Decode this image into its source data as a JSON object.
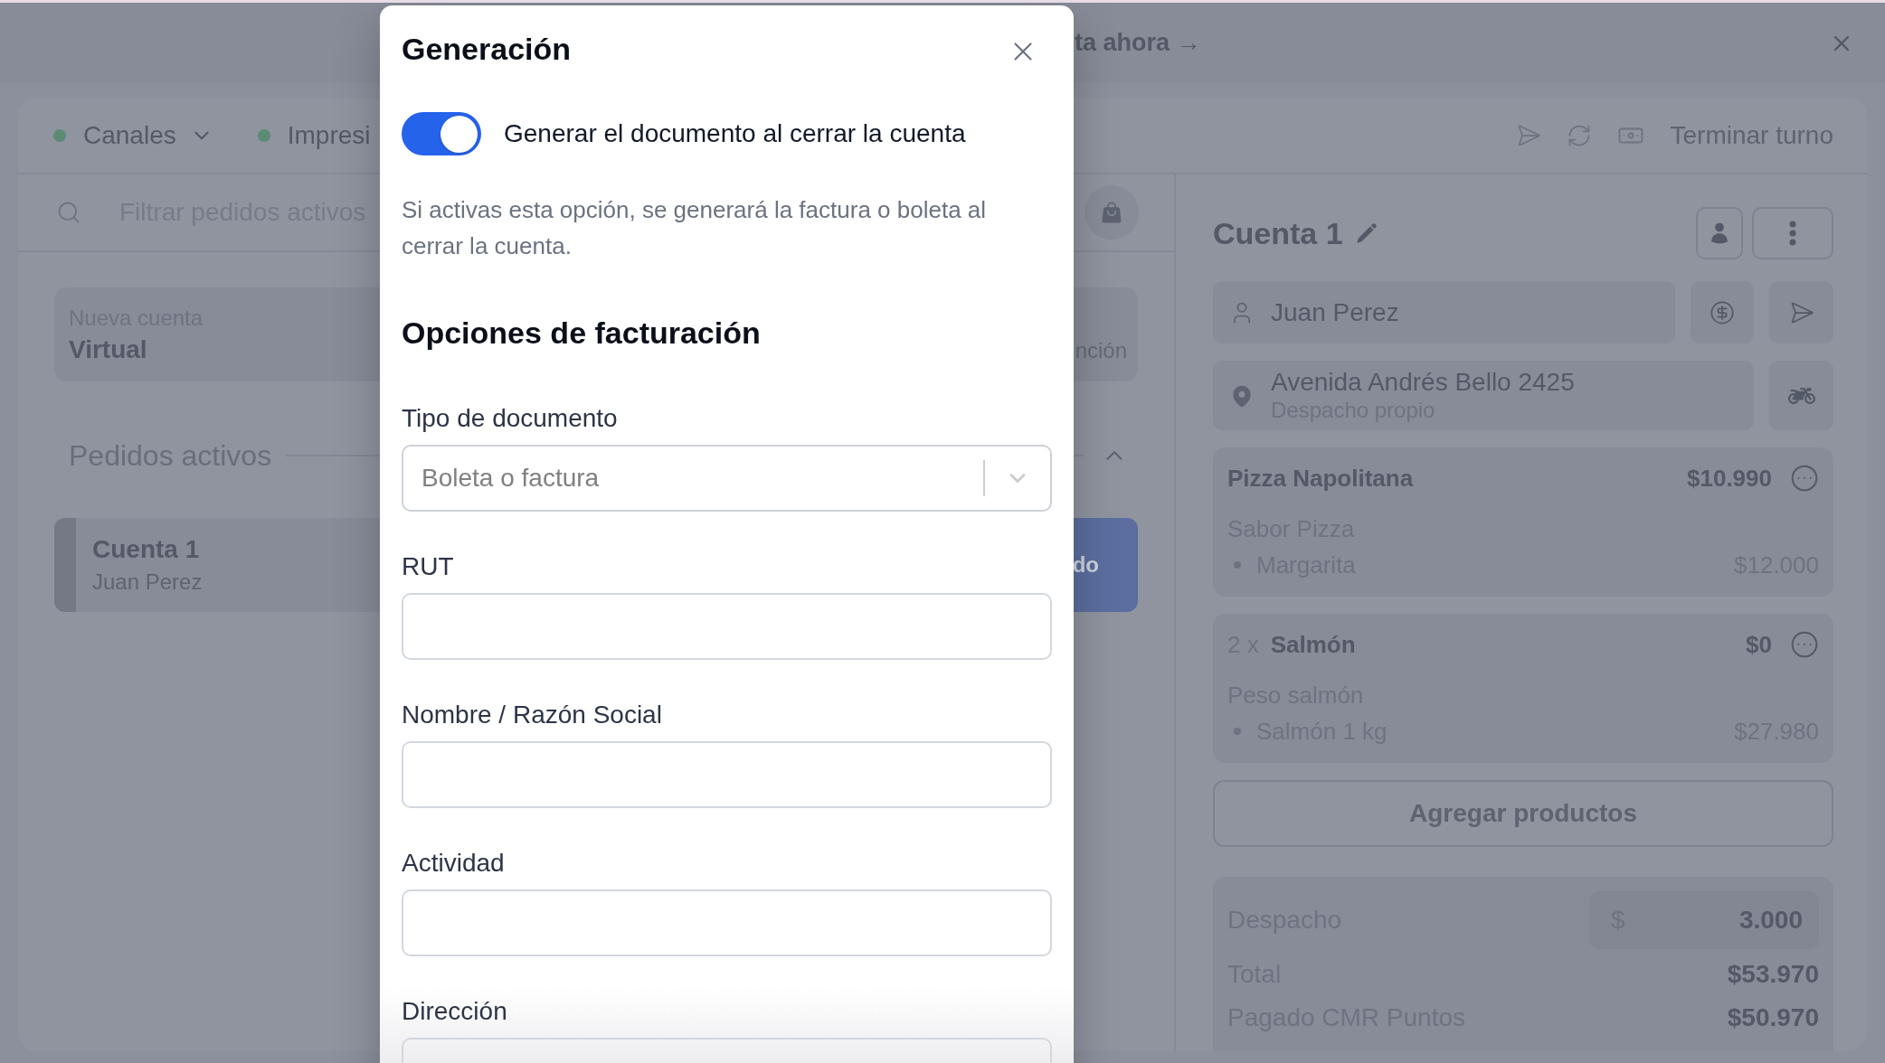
{
  "banner": {
    "text": "ta ahora →"
  },
  "header": {
    "channel_menu": {
      "label": "Canales",
      "connected": true
    },
    "printer_status": {
      "label": "Impresi",
      "connected": true
    },
    "end_shift": "Terminar turno"
  },
  "orders": {
    "search": {
      "placeholder": "Filtrar pedidos activos"
    },
    "new_account": {
      "label": "Nueva cuenta",
      "value": "Virtual"
    },
    "tile_2": {
      "text": "nción"
    },
    "section_title": "Pedidos activos",
    "expanded": true,
    "accounts": [
      {
        "name": "Cuenta 1",
        "customer": "Juan Perez",
        "selected": true,
        "button": "do"
      }
    ]
  },
  "account": {
    "title": "Cuenta 1",
    "customer": "Juan Perez",
    "address": "Avenida Andrés Bello 2425",
    "delivery": "Despacho propio",
    "items": [
      {
        "name": "Pizza Napolitana",
        "price": "$10.990",
        "option_group": "Sabor Pizza",
        "options": [
          {
            "name": "Margarita",
            "price": "$12.000"
          }
        ]
      },
      {
        "quantity": "2 x",
        "name": "Salmón",
        "price": "$0",
        "option_group": "Peso salmón",
        "options": [
          {
            "name": "Salmón 1 kg",
            "price": "$27.980"
          }
        ]
      }
    ],
    "add_button": "Agregar productos",
    "shipping": {
      "label": "Despacho",
      "currency": "$",
      "value": "3.000"
    },
    "totals": [
      {
        "label": "Total",
        "value": "$53.970"
      },
      {
        "label": "Pagado CMR Puntos",
        "value": "$50.970"
      }
    ]
  },
  "modal": {
    "title": "Generación",
    "toggle": {
      "label": "Generar el documento al cerrar la cuenta",
      "on": true
    },
    "description": "Si activas esta opción, se generará la factura o boleta al cerrar la cuenta.",
    "section_title": "Opciones de facturación",
    "fields": [
      {
        "kind": "select",
        "label": "Tipo de documento",
        "placeholder": "Boleta o factura"
      },
      {
        "kind": "text",
        "label": "RUT"
      },
      {
        "kind": "text",
        "label": "Nombre / Razón Social"
      },
      {
        "kind": "text",
        "label": "Actividad"
      },
      {
        "kind": "text",
        "label": "Dirección"
      }
    ]
  }
}
